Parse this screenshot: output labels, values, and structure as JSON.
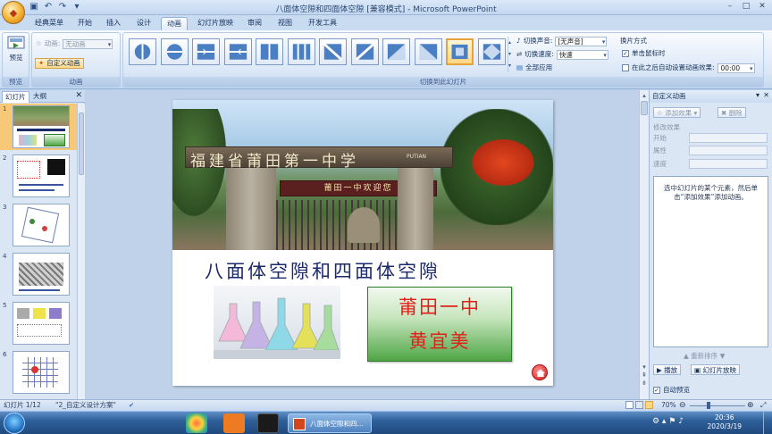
{
  "window": {
    "title": "八面体空隙和四面体空隙 [兼容模式] - Microsoft PowerPoint"
  },
  "ribbon_tabs": [
    "经典菜单",
    "开始",
    "插入",
    "设计",
    "动画",
    "幻灯片放映",
    "审阅",
    "视图",
    "开发工具"
  ],
  "active_tab": "动画",
  "ribbon": {
    "preview": {
      "button_label": "预览",
      "group_label": "预览"
    },
    "animation": {
      "animate_label": "动画:",
      "animate_value": "无动画",
      "custom_label": "自定义动画",
      "group_label": "动画"
    },
    "transitions": {
      "group_label": "切换到此幻灯片",
      "count": 12,
      "selected_index": 10
    },
    "sound_label": "切换声音:",
    "sound_value": "[无声音]",
    "speed_label": "切换速度:",
    "speed_value": "快速",
    "apply_all_label": "全部应用",
    "advance": {
      "header": "换片方式",
      "on_click_label": "单击鼠标时",
      "on_click_checked": true,
      "auto_label": "在此之后自动设置动画效果:",
      "auto_checked": false,
      "auto_value": "00:00"
    }
  },
  "left_panel": {
    "tabs": [
      "幻灯片",
      "大纲"
    ],
    "slide_numbers": [
      "1",
      "2",
      "3",
      "4",
      "5",
      "6"
    ]
  },
  "slide": {
    "banner_text": "福建省莆田第一中学",
    "sign_text": "莆田一中欢迎您",
    "school_en": "PUTIAN",
    "title": "八面体空隙和四面体空隙",
    "box_line1": "莆田一中",
    "box_line2": "黄宜美"
  },
  "task_pane": {
    "title": "自定义动画",
    "add_effect": "添加效果",
    "remove": "删除",
    "modify_header": "修改效果",
    "start_label": "开始",
    "property_label": "属性",
    "speed_label": "速度",
    "hint": "选中幻灯片的某个元素，然后单击“添加效果”添加动画。",
    "reorder_label": "重新排序",
    "play_label": "播放",
    "slideshow_label": "幻灯片放映",
    "autopreview_label": "自动预览",
    "autopreview_checked": true
  },
  "status": {
    "slide_info": "幻灯片 1/12",
    "theme": "\"2_自定义设计方案\"",
    "zoom": "70%"
  },
  "taskbar": {
    "active_window": "八面体空隙和四...",
    "time": "20:36",
    "date": "2020/3/19"
  },
  "colors": {
    "ribbon_bg": "#dce8f7",
    "active_thumb": "#f7c875",
    "slide_title": "#1b2a6b",
    "box_text": "#e0201b",
    "box_green": "#4fa646"
  }
}
